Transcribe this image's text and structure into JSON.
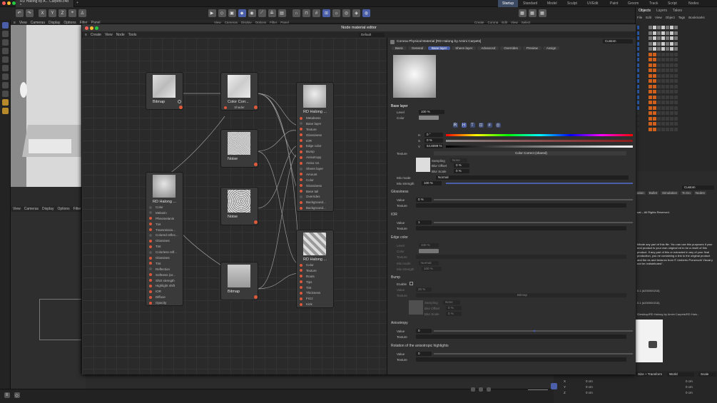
{
  "app": {
    "doc_tab": "RD Halong by A... Carpets.c4d *",
    "workspaces": [
      "Startup",
      "Standard",
      "Model",
      "Sculpt",
      "UVEdit",
      "Paint",
      "Groom",
      "Track",
      "Script",
      "Nodes"
    ],
    "active_workspace": "Startup"
  },
  "viewport_menu": [
    "View",
    "Cameras",
    "Display",
    "Options",
    "Filter",
    "Panel"
  ],
  "viewport2_menu": [
    "View",
    "Cameras",
    "Display",
    "Options",
    "Filter"
  ],
  "top_menu_right": [
    "View",
    "Cameras",
    "Display",
    "Options",
    "Filter",
    "Panel"
  ],
  "top_menu_right2": [
    "Create",
    "Corona",
    "Edit",
    "View",
    "Select"
  ],
  "objects_tabs": [
    "Objects",
    "Layers",
    "Takes"
  ],
  "objects_menu": [
    "File",
    "Edit",
    "View",
    "Object",
    "Tags",
    "Bookmarks"
  ],
  "node_editor": {
    "title": "Node material editor",
    "menu": [
      "Create",
      "View",
      "Node",
      "Tools"
    ],
    "preset": "Default",
    "nodes": {
      "bitmap1": "Bitmap",
      "color_correct": "Color Corr...",
      "color_correct_port": "Shader",
      "noise1": "Noise",
      "noise2": "Noise",
      "bitmap2": "Bitmap",
      "rd_main": "RD Halong ...",
      "rd_main_ports": [
        "Metalness",
        "Base layer",
        "Texture",
        "Glossiness",
        "IOR",
        "Edge color",
        "Bump",
        "Anisotropy",
        "Aniso rot.",
        "Sheen layer",
        "Amount",
        "Color",
        "Glossiness",
        "Base tail",
        "Overrides",
        "Background...",
        "Background..."
      ],
      "rd_left": "RD Halong ...",
      "rd_left_ports": [
        "Color",
        "Melanin",
        "Pheomelanin",
        "Tint",
        "Transmissio...",
        "Colored reflec...",
        "Glossines",
        "Tint",
        "Colorless refl...",
        "Glossines",
        "Tint",
        "Reflection",
        "Softness (ar...",
        "Shirt strength",
        "Highlight shift",
        "IOR",
        "Diffuse",
        "Opacity"
      ],
      "rd_bottom": "RD Halong ...",
      "rd_bottom_ports": [
        "Color",
        "Texture",
        "Roots",
        "Tips",
        "Tint",
        "Thickness",
        "Frizz",
        "Kink"
      ]
    },
    "attr": {
      "material": "Corona Physical Material [RD Halong by Amini Carpets]",
      "mode": "Custom",
      "tabs": [
        "Basic",
        "General",
        "Base layer",
        "Sheen layer",
        "Advanced",
        "Overrides",
        "Preview",
        "Assign"
      ],
      "active_tab": "Base layer",
      "base_layer": "Base layer",
      "level_label": "Level",
      "level_value": "100 %",
      "color_label": "Color",
      "h_label": "H",
      "h_value": "0 °",
      "s_label": "S",
      "s_value": "0 %",
      "v_label": "V",
      "v_value": "54.8099 %",
      "texture_label": "Texture",
      "texture_value": "Color Correct (shared)",
      "sampling_label": "Sampling",
      "sampling_value": "None",
      "blur_offset_label": "Blur Offset",
      "blur_offset_value": "0 %",
      "blur_scale_label": "Blur Scale",
      "blur_scale_value": "0 %",
      "mix_mode_label": "Mix mode",
      "mix_mode_value": "Normal",
      "mix_strength_label": "Mix strength",
      "mix_strength_value": "100 %",
      "glossiness": "Glossiness",
      "g_value_label": "Value",
      "g_value": "0 %",
      "g_texture_label": "Texture",
      "ior": "IOR",
      "ior_value_label": "Value",
      "ior_value": "1",
      "ior_texture_label": "Texture",
      "edge_color": "Edge color",
      "ec_level_label": "Level",
      "ec_level": "100 %",
      "ec_color_label": "Color",
      "ec_texture_label": "Texture",
      "ec_mix_mode_label": "Mix mode",
      "ec_mix_mode": "Normal",
      "ec_mix_strength_label": "Mix strength",
      "ec_mix_strength": "100 %",
      "bump": "Bump",
      "bump_enable_label": "Enable",
      "bump_value_label": "Value",
      "bump_value": "25 %",
      "bump_texture_label": "Texture",
      "bump_texture_value": "Bitmap",
      "bump_sampling_label": "Sampling",
      "bump_sampling": "None",
      "bump_blur_offset_label": "Blur Offset",
      "bump_blur_offset": "0 %",
      "bump_blur_scale_label": "Blur Scale",
      "bump_blur_scale": "0 %",
      "anisotropy": "Anisotropy",
      "an_value_label": "Value",
      "an_value": "0",
      "an_texture_label": "Texture",
      "rotation": "Rotation of the anisotropic highlights",
      "rot_value_label": "Value",
      "rot_value": "0",
      "rot_texture_label": "Texture"
    }
  },
  "right_attr": {
    "mode": "Custom",
    "tabs": [
      "ation",
      "Bullet",
      "Simulation",
      "To Do",
      "Nodes"
    ],
    "copyright": "ual – All Rights Reserved.",
    "license_text": "tribute any part of this file. You can use this purposes if your end product is your own original ed to be a resell of this product. If any part of this or extracted in any of your final production, you ne containing a link to the original product and the es and textures from © Umberto Ponzecchi Visual y not be redistributed\".",
    "id1": "0.1 (#200000218)",
    "id2": "0.1 (#200000218)",
    "path": "/Desktop/RD Halong by Amini Carpets/RD Halo..."
  },
  "coords": {
    "headers": [
      "Size + Transform",
      "World",
      "Scale"
    ],
    "rows": [
      {
        "axis": "X",
        "a": "0 cm",
        "b": "0 cm"
      },
      {
        "axis": "Y",
        "a": "0 cm",
        "b": "0 cm"
      },
      {
        "axis": "Z",
        "a": "0 cm",
        "b": "0 cm"
      }
    ]
  }
}
